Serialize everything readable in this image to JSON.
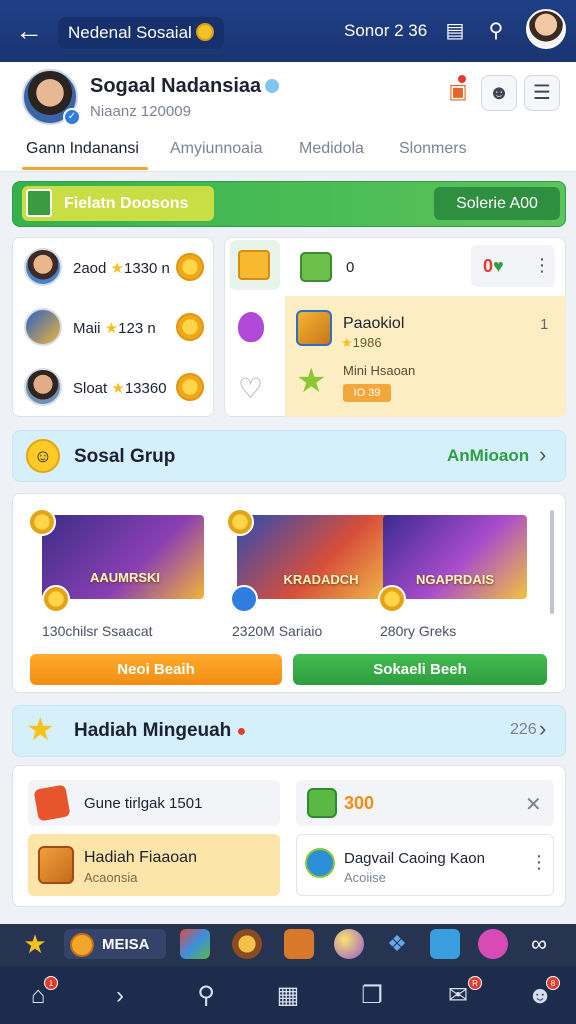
{
  "topbar": {
    "title": "Nedenal Sosaial",
    "stat": "Sonor 2 36"
  },
  "profile": {
    "name": "Sogaal Nadansiaa",
    "sub": "Niaanz 120009"
  },
  "tabs": [
    "Gann Indanansi",
    "Amyiunnoaia",
    "Medidola",
    "Slonmers"
  ],
  "banner": {
    "left": "Fielatn Doosons",
    "right": "Solerie A00"
  },
  "leaderboard": [
    {
      "name": "2aod",
      "score": "1330 n"
    },
    {
      "name": "Maii",
      "score": "123 n"
    },
    {
      "name": "Sloat",
      "score": "13360"
    }
  ],
  "side_panel": {
    "count": "0",
    "badge_value": "0",
    "gift_title": "Paaokiol",
    "gift_stars": "1986",
    "gift_sub": "Mini Hsaoan",
    "gift_button": "IO 39",
    "gift_num": "1"
  },
  "social": {
    "title": "Sosal Grup",
    "action": "AnMioaon",
    "cards": [
      {
        "caption": "130chilsr Ssaacat",
        "thumb_text": "AAUMRSKI"
      },
      {
        "caption": "2320M Sariaio",
        "thumb_text": "KRADADCH"
      },
      {
        "caption": "280ry Greks",
        "thumb_text": "NGAPRDAIS"
      }
    ],
    "btn_left": "Neoi Beaih",
    "btn_right": "Sokaeli Beeh"
  },
  "daily": {
    "title": "Hadiah Mingeuah",
    "count": "226",
    "items": [
      {
        "title": "Gune tirlgak 1501",
        "sub": ""
      },
      {
        "title": "300",
        "sub": ""
      },
      {
        "title": "Hadiah Fiaaoan",
        "sub": "Acaonsia"
      },
      {
        "title": "Dagvail Caoing Kaon",
        "sub": "Acoiise"
      }
    ]
  },
  "bottom_strip": {
    "label": "MEISA"
  },
  "nav_badges": {
    "home": "1",
    "profile": "8"
  }
}
